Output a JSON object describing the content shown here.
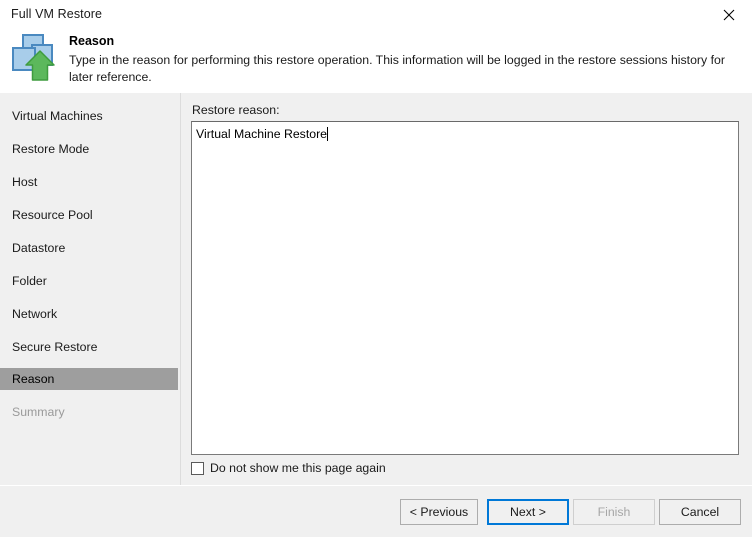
{
  "window": {
    "title": "Full VM Restore",
    "close_label": "Close",
    "close_icon": "close-icon"
  },
  "header": {
    "icon": "vm-restore-icon",
    "title": "Reason",
    "description": "Type in the reason for performing this restore operation. This information will be logged in the restore sessions history for later reference."
  },
  "sidebar": {
    "items": [
      {
        "label": "Virtual Machines",
        "state": "normal"
      },
      {
        "label": "Restore Mode",
        "state": "normal"
      },
      {
        "label": "Host",
        "state": "normal"
      },
      {
        "label": "Resource Pool",
        "state": "normal"
      },
      {
        "label": "Datastore",
        "state": "normal"
      },
      {
        "label": "Folder",
        "state": "normal"
      },
      {
        "label": "Network",
        "state": "normal"
      },
      {
        "label": "Secure Restore",
        "state": "normal"
      },
      {
        "label": "Reason",
        "state": "active"
      },
      {
        "label": "Summary",
        "state": "disabled"
      }
    ]
  },
  "main": {
    "field_label": "Restore reason:",
    "reason_value": "Virtual Machine Restore",
    "reason_placeholder": "",
    "checkbox": {
      "label": "Do not show me this page again",
      "checked": false
    }
  },
  "footer": {
    "buttons": [
      {
        "label": "< Previous",
        "state": "normal"
      },
      {
        "label": "Next >",
        "state": "default"
      },
      {
        "label": "Finish",
        "state": "disabled"
      },
      {
        "label": "Cancel",
        "state": "normal"
      }
    ]
  },
  "colors": {
    "accent": "#0078d7",
    "window_bg": "#f0f0f0",
    "header_bg": "#ffffff",
    "active_nav_bg": "#9e9e9e",
    "disabled_text": "#9a9a9a",
    "icon_blue": "#6ba3d6",
    "icon_green": "#5cb85c"
  }
}
